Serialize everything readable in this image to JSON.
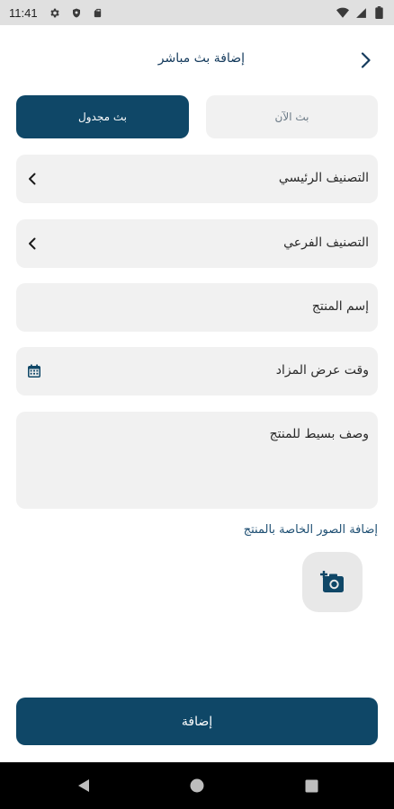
{
  "status_bar": {
    "time": "11:41",
    "left_icons": [
      "gear-icon",
      "shield-icon",
      "sd-card-icon"
    ],
    "right_icons": [
      "wifi-icon",
      "cellular-icon",
      "battery-icon"
    ]
  },
  "header": {
    "title": "إضافة بث مباشر",
    "back_icon": "chevron-right-icon"
  },
  "broadcast_toggle": {
    "scheduled_label": "بث مجدول",
    "now_label": "بث الآن",
    "selected": "scheduled"
  },
  "form": {
    "main_category": "التصنيف الرئيسي",
    "sub_category": "التصنيف الفرعي",
    "product_name": "إسم المنتج",
    "auction_time": "وقت عرض المزاد",
    "description": "وصف بسيط للمنتج"
  },
  "images": {
    "label": "إضافة الصور الخاصة بالمنتج",
    "add_icon": "add-photo-icon"
  },
  "submit_label": "إضافة",
  "colors": {
    "primary": "#0f4767",
    "field_bg": "#f1f1f1",
    "link": "#1d4e72"
  }
}
